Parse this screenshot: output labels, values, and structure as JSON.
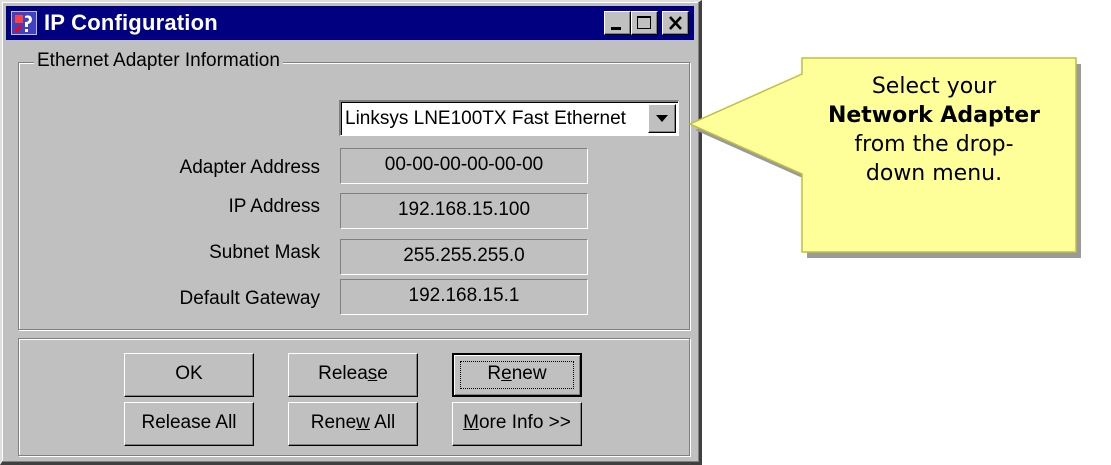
{
  "window": {
    "title": "IP Configuration"
  },
  "group": {
    "legend": "Ethernet  Adapter Information"
  },
  "adapter_select": {
    "value": "Linksys LNE100TX Fast Ethernet"
  },
  "fields": [
    {
      "label": "Adapter Address",
      "value": "00-00-00-00-00-00"
    },
    {
      "label": "IP Address",
      "value": "192.168.15.100"
    },
    {
      "label": "Subnet Mask",
      "value": "255.255.255.0"
    },
    {
      "label": "Default Gateway",
      "value": "192.168.15.1"
    }
  ],
  "buttons": {
    "ok": {
      "pre": "OK",
      "key": "",
      "post": ""
    },
    "release": {
      "pre": "Relea",
      "key": "s",
      "post": "e"
    },
    "renew": {
      "pre": "R",
      "key": "e",
      "post": "new"
    },
    "release_all": {
      "pre": "Release All",
      "key": "",
      "post": ""
    },
    "renew_all": {
      "pre": "Rene",
      "key": "w",
      "post": " All"
    },
    "more_info": {
      "pre": "",
      "key": "M",
      "post": "ore Info >>"
    }
  },
  "callout": {
    "line1": "Select your",
    "line2": "Network Adapter",
    "line3": "from the drop-",
    "line4": "down menu."
  },
  "icons": [
    "app-icon",
    "minimize-icon",
    "maximize-icon",
    "close-icon",
    "dropdown-arrow-icon",
    "callout-arrow"
  ],
  "colors": {
    "titlebar": "#000080",
    "window_face": "#c0c0c0",
    "callout_fill": "#ffff99"
  }
}
